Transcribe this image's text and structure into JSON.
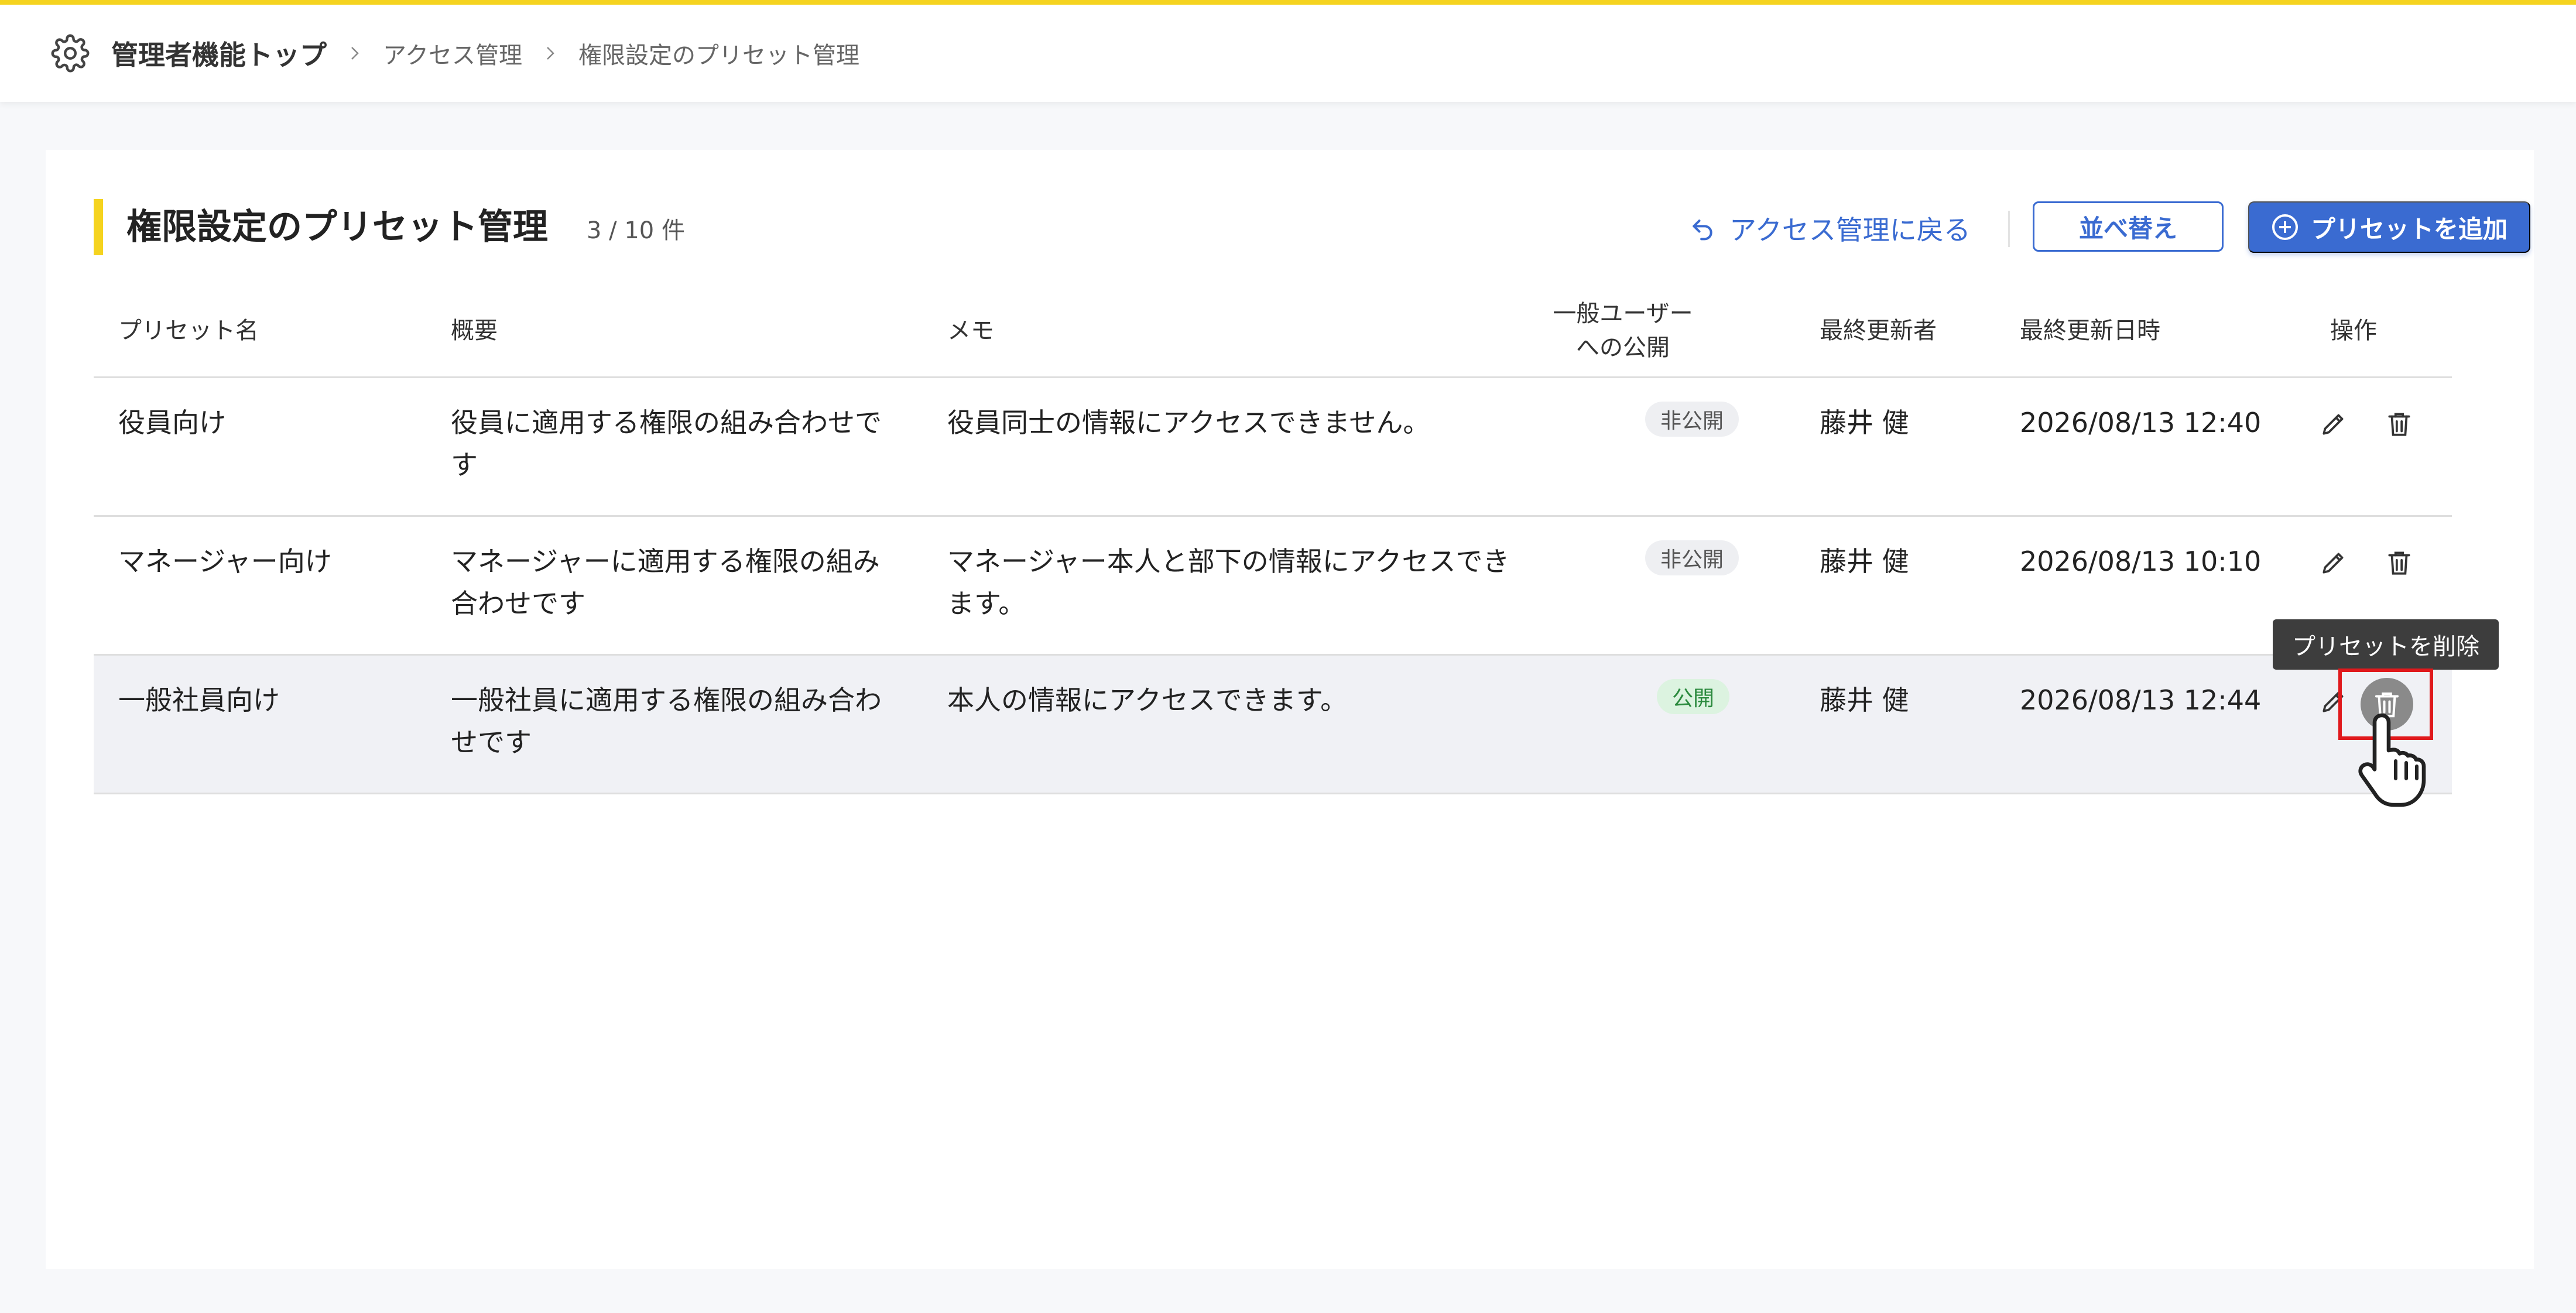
{
  "breadcrumb": {
    "home": "管理者機能トップ",
    "items": [
      "アクセス管理",
      "権限設定のプリセット管理"
    ]
  },
  "page": {
    "title": "権限設定のプリセット管理",
    "count": "3 / 10 件",
    "back_label": "アクセス管理に戻る",
    "sort_label": "並べ替え",
    "add_label": "プリセットを追加"
  },
  "table": {
    "headers": {
      "name": "プリセット名",
      "summary": "概要",
      "memo": "メモ",
      "public_line1": "一般ユーザー",
      "public_line2": "への公開",
      "updated_by": "最終更新者",
      "updated_at": "最終更新日時",
      "operations": "操作"
    },
    "rows": [
      {
        "name": "役員向け",
        "summary": "役員に適用する権限の組み合わせです",
        "memo": "役員同士の情報にアクセスできません。",
        "public": "非公開",
        "updated_by": "藤井 健",
        "updated_at": "2026/08/13 12:40"
      },
      {
        "name": "マネージャー向け",
        "summary": "マネージャーに適用する権限の組み合わせです",
        "memo": "マネージャー本人と部下の情報にアクセスできます。",
        "public": "非公開",
        "updated_by": "藤井 健",
        "updated_at": "2026/08/13 10:10"
      },
      {
        "name": "一般社員向け",
        "summary": "一般社員に適用する権限の組み合わせです",
        "memo": "本人の情報にアクセスできます。",
        "public": "公開",
        "updated_by": "藤井 健",
        "updated_at": "2026/08/13 12:44"
      }
    ]
  },
  "tooltip": {
    "delete": "プリセットを削除"
  },
  "colors": {
    "accent": "#3a6bd1",
    "brand_yellow": "#f5d31f",
    "highlight_red": "#e0191c",
    "public_green": "#2b8a3e"
  },
  "icons": {
    "settings": "gear-icon",
    "separator": "chevron-right-icon",
    "back": "undo-arrow-icon",
    "add": "plus-circle-icon",
    "edit": "pencil-icon",
    "delete": "trash-icon",
    "cursor": "hand-pointer-icon"
  }
}
